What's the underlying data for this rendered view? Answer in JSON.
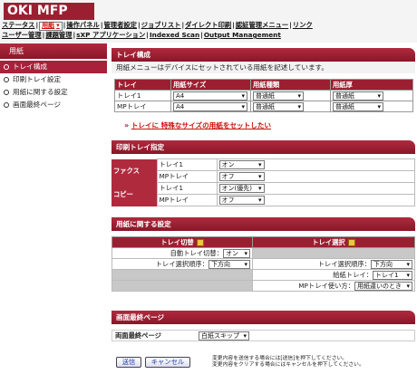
{
  "app": {
    "title": "OKI MFP"
  },
  "nav": {
    "row1": [
      "ステータス",
      "用紙",
      "操作パネル",
      "管理者設定",
      "ジョブリスト",
      "ダイレクト印刷",
      "認証管理メニュー",
      "リンク"
    ],
    "row2": [
      "ユーザー管理",
      "課題管理",
      "sXP アプリケーション",
      "Indexed Scan",
      "Output Management"
    ]
  },
  "sidebar": {
    "title": "用紙",
    "items": [
      "トレイ構成",
      "印刷トレイ設定",
      "用紙に関する設定",
      "画面最終ページ"
    ]
  },
  "tray_config": {
    "title": "トレイ構成",
    "description": "用紙メニューはデバイスにセットされている用紙を記述しています。",
    "columns": [
      "トレイ",
      "用紙サイズ",
      "用紙種類",
      "用紙厚"
    ],
    "rows": [
      {
        "tray": "トレイ1",
        "size": "A4",
        "type": "普通紙",
        "weight": "普通紙"
      },
      {
        "tray": "MPトレイ",
        "size": "A4",
        "type": "普通紙",
        "weight": "普通紙"
      }
    ],
    "special_link": "トレイに 特殊なサイズの用紙をセットしたい"
  },
  "print_tray": {
    "title": "印刷トレイ指定",
    "groups": [
      {
        "label": "ファクス",
        "rows": [
          {
            "tray": "トレイ1",
            "value": "オン"
          },
          {
            "tray": "MPトレイ",
            "value": "オフ"
          }
        ]
      },
      {
        "label": "コピー",
        "rows": [
          {
            "tray": "トレイ1",
            "value": "オン(優先)"
          },
          {
            "tray": "MPトレイ",
            "value": "オフ"
          }
        ]
      }
    ]
  },
  "paper_settings": {
    "title": "用紙に関する設定",
    "left_header": "トレイ切替",
    "right_header": "トレイ選択",
    "auto_switch_label": "自動トレイ切替：",
    "auto_switch_value": "オン",
    "select_order_label": "トレイ選択順序：",
    "select_order_value": "下方向",
    "right_order_label": "トレイ選択順序：",
    "right_order_value": "下方向",
    "feed_tray_label": "給紙トレイ：",
    "feed_tray_value": "トレイ1",
    "mp_use_label": "MPトレイ使い方：",
    "mp_use_value": "用紙違いのとき"
  },
  "last_page": {
    "title": "画面最終ページ",
    "label": "両面最終ページ",
    "value": "白紙スキップ"
  },
  "footer": {
    "submit": "送信",
    "cancel": "キャンセル",
    "note1": "変更内容を送信する場合には[送信]を押下してください。",
    "note2": "変更内容をクリアする場合にはキャンセルを押下してください。"
  },
  "colors": {
    "accent": "#9c1f31"
  }
}
